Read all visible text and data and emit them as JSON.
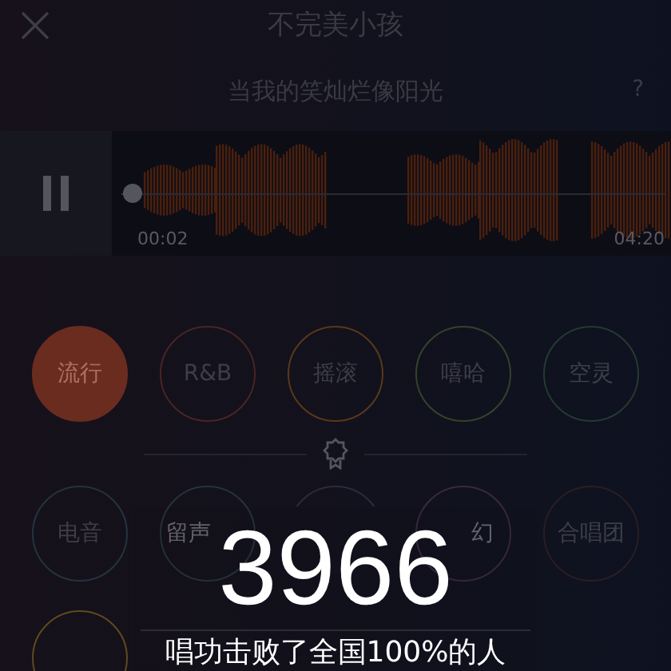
{
  "header": {
    "title": "不完美小孩"
  },
  "lyric": {
    "text": "当我的笑灿烂像阳光",
    "help": "?"
  },
  "player": {
    "playing": true,
    "level": 0.02,
    "elapsed": "00:02",
    "total": "04:20"
  },
  "styles": [
    {
      "label": "流行",
      "selected": true,
      "color": "#6b2c20"
    },
    {
      "label": "R&B",
      "selected": false,
      "color": "#4a2424"
    },
    {
      "label": "摇滚",
      "selected": false,
      "color": "#5a3818"
    },
    {
      "label": "嘻哈",
      "selected": false,
      "color": "#34422a"
    },
    {
      "label": "空灵",
      "selected": false,
      "color": "#243a30"
    }
  ],
  "effects": [
    {
      "label": "电音",
      "selected": false,
      "color": "#22343f"
    },
    {
      "label": "留声",
      "selected": false,
      "color": "#26323f"
    },
    {
      "selected": false,
      "color": "#2e2a3c"
    },
    {
      "label": "幻",
      "selected": false,
      "color": "#3a2a3a"
    },
    {
      "label": "合唱团",
      "selected": false,
      "color": "#2a1e22"
    }
  ],
  "more": [
    {
      "color": "#5e4a1e"
    }
  ],
  "result": {
    "score": "3966",
    "summary": "唱功击败了全国100%的人"
  }
}
